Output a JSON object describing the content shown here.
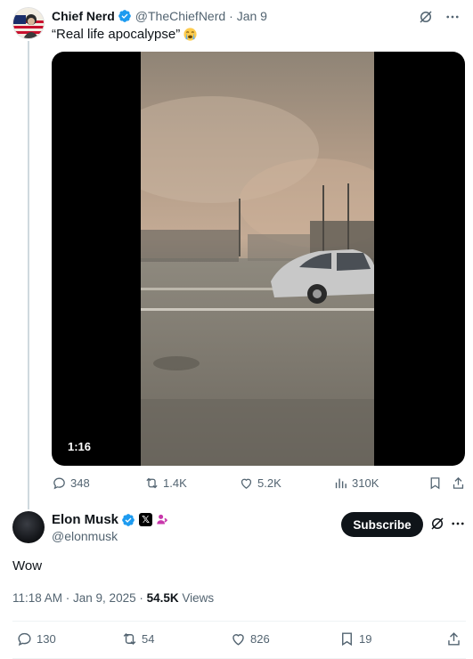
{
  "quoted": {
    "name": "Chief Nerd",
    "handle": "@TheChiefNerd",
    "date": "· Jan 9",
    "text": "“Real life apocalypse”",
    "duration": "1:16",
    "actions": {
      "replies": "348",
      "reposts": "1.4K",
      "likes": "5.2K",
      "views": "310K"
    }
  },
  "tweet": {
    "name": "Elon Musk",
    "handle": "@elonmusk",
    "subscribe_label": "Subscribe",
    "body": "Wow",
    "timestamp": "11:18 AM · Jan 9, 2025 · ",
    "views_count": "54.5K",
    "views_label": " Views",
    "actions": {
      "replies": "130",
      "reposts": "54",
      "likes": "826",
      "bookmarks": "19"
    }
  },
  "icons": {
    "verified": "verified-badge-icon",
    "grok": "grok-icon",
    "more": "more-icon",
    "reply": "reply-icon",
    "repost": "repost-icon",
    "like": "like-icon",
    "views": "views-icon",
    "bookmark": "bookmark-icon",
    "share": "share-icon"
  },
  "colors": {
    "verified": "#1d9bf0",
    "text": "#0f1419",
    "muted": "#536471",
    "subscribe_bg": "#0f1419"
  }
}
